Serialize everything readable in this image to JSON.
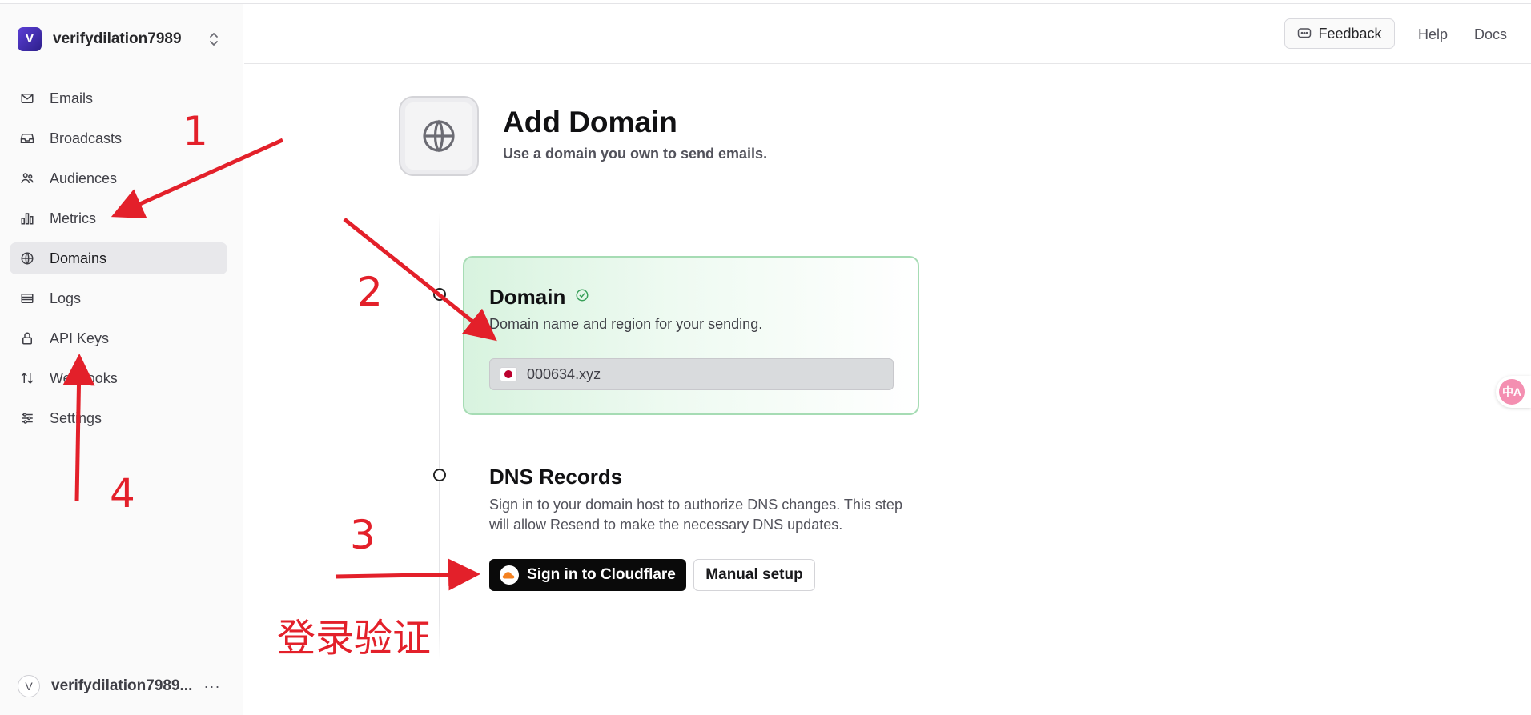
{
  "team": {
    "badge": "V",
    "name": "verifydilation7989"
  },
  "sidebar": {
    "items": [
      {
        "label": "Emails",
        "icon": "mail-icon"
      },
      {
        "label": "Broadcasts",
        "icon": "inbox-icon"
      },
      {
        "label": "Audiences",
        "icon": "users-icon"
      },
      {
        "label": "Metrics",
        "icon": "bar-chart-icon"
      },
      {
        "label": "Domains",
        "icon": "globe-icon",
        "active": true
      },
      {
        "label": "Logs",
        "icon": "logs-icon"
      },
      {
        "label": "API Keys",
        "icon": "lock-icon"
      },
      {
        "label": "Webhooks",
        "icon": "arrows-icon"
      },
      {
        "label": "Settings",
        "icon": "sliders-icon"
      }
    ]
  },
  "user": {
    "avatar": "V",
    "name": "verifydilation7989...",
    "more": "···"
  },
  "topbar": {
    "feedback": "Feedback",
    "help": "Help",
    "docs": "Docs"
  },
  "page": {
    "title": "Add Domain",
    "subtitle": "Use a domain you own to send emails."
  },
  "domain_step": {
    "title": "Domain",
    "subtitle": "Domain name and region for your sending.",
    "value": "000634.xyz",
    "status_color": "#3aa05a"
  },
  "dns_step": {
    "title": "DNS Records",
    "description": "Sign in to your domain host to authorize DNS changes. This step will allow Resend to make the necessary DNS updates.",
    "cloudflare_button": "Sign in to Cloudflare",
    "manual_button": "Manual setup"
  },
  "translate_widget": {
    "label": "中A"
  },
  "annotations": {
    "numbers": [
      "1",
      "2",
      "3",
      "4"
    ],
    "note": "登录验证",
    "color": "#e3202a"
  }
}
